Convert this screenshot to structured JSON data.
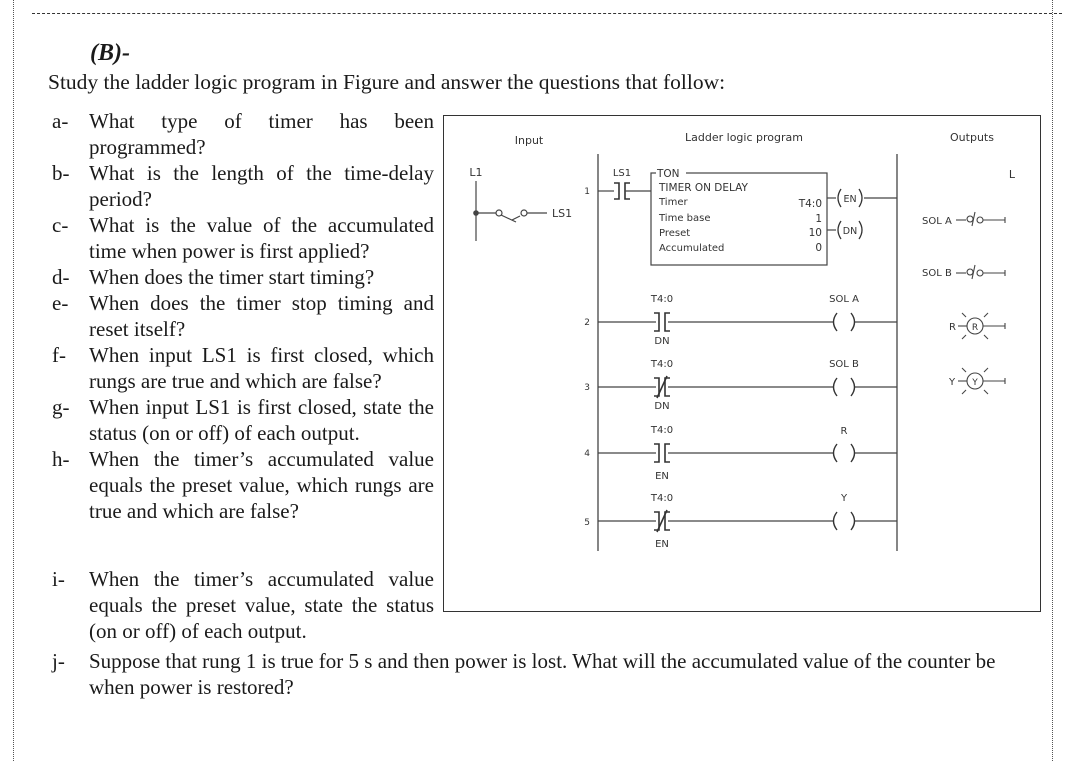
{
  "section_label": "(B)-",
  "intro": "Study the ladder logic program in Figure and answer the questions that follow:",
  "questions": [
    {
      "label": "a-",
      "text": "What type of timer has been programmed?"
    },
    {
      "label": "b-",
      "text": "What is the length of the time-delay period?"
    },
    {
      "label": "c-",
      "text": "What is the value of the accumulated time when power is first applied?"
    },
    {
      "label": "d-",
      "text": "When does the timer start timing?"
    },
    {
      "label": "e-",
      "text": "When does the timer stop timing and reset itself?"
    },
    {
      "label": "f-",
      "text": "When input LS1 is first closed, which rungs are true and which are false?"
    },
    {
      "label": "g-",
      "text": "When input LS1 is first closed, state the status (on or off) of each output."
    },
    {
      "label": "h-",
      "text": "When the timer’s accumulated value equals the preset value, which rungs are true and which are false?"
    },
    {
      "label": "i-",
      "text": "When the timer’s accumulated value equals the preset value, state the status (on or off) of each output."
    },
    {
      "label": "j-",
      "text": "Suppose that rung 1 is true for 5 s and then power is lost. What will the accumulated value of the counter be when power is restored?"
    }
  ],
  "figure": {
    "headers": {
      "input": "Input",
      "ladder": "Ladder logic program",
      "outputs": "Outputs"
    },
    "input": {
      "line": "L1",
      "switch": "LS1",
      "neutral": "L"
    },
    "timer_block": {
      "type": "TON",
      "title": "TIMER ON DELAY",
      "fields": [
        {
          "name": "Timer",
          "value": "T4:0"
        },
        {
          "name": "Time base",
          "value": "1"
        },
        {
          "name": "Preset",
          "value": "10"
        },
        {
          "name": "Accumulated",
          "value": "0"
        }
      ],
      "bits": [
        "EN",
        "DN"
      ]
    },
    "rungs": [
      {
        "number": "1",
        "contact_tag": "LS1",
        "contact_type": "NO",
        "contact_bit": ""
      },
      {
        "number": "2",
        "contact_tag": "T4:0",
        "contact_type": "NO",
        "contact_bit": "DN",
        "coil": "SOL A"
      },
      {
        "number": "3",
        "contact_tag": "T4:0",
        "contact_type": "NC",
        "contact_bit": "DN",
        "coil": "SOL B"
      },
      {
        "number": "4",
        "contact_tag": "T4:0",
        "contact_type": "NO",
        "contact_bit": "EN",
        "coil": "R"
      },
      {
        "number": "5",
        "contact_tag": "T4:0",
        "contact_type": "NC",
        "contact_bit": "EN",
        "coil": "Y"
      }
    ],
    "outputs": [
      {
        "label": "SOL A",
        "kind": "solenoid"
      },
      {
        "label": "SOL B",
        "kind": "solenoid"
      },
      {
        "label": "R",
        "kind": "lamp",
        "lamp_text": "R"
      },
      {
        "label": "Y",
        "kind": "lamp",
        "lamp_text": "Y"
      }
    ]
  }
}
